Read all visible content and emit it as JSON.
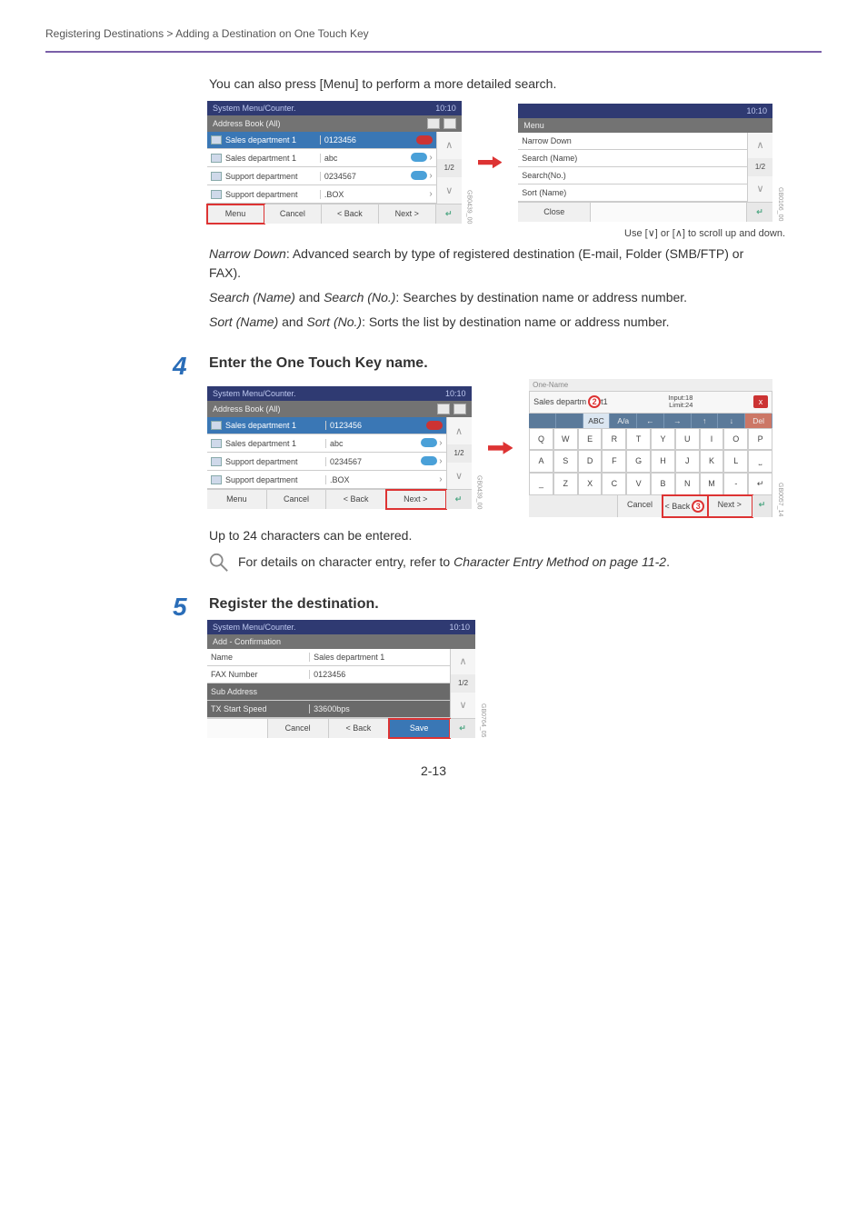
{
  "breadcrumb": "Registering Destinations > Adding a Destination on One Touch Key",
  "intro": "You can also press [Menu] to perform a more detailed search.",
  "scroll_note_pre": "Use [",
  "scroll_note_mid": "] or [",
  "scroll_note_post": "] to scroll up and down.",
  "defs": {
    "narrow_label": "Narrow Down",
    "narrow_text": ": Advanced search by type of registered destination (E-mail, Folder (SMB/FTP) or FAX).",
    "search_label_a": "Search (Name)",
    "and1": " and ",
    "search_label_b": "Search (No.)",
    "search_text": ": Searches by destination name or address number.",
    "sort_label_a": "Sort (Name)",
    "and2": " and ",
    "sort_label_b": "Sort (No.)",
    "sort_text": ": Sorts the list by destination name or address number."
  },
  "step4": {
    "num": "4",
    "title": "Enter the One Touch Key name.",
    "limit_note": "Up to 24 characters can be entered.",
    "refer_pre": "For details on character entry, refer to ",
    "refer_link": "Character Entry Method on page 11-2",
    "refer_post": "."
  },
  "step5": {
    "num": "5",
    "title": "Register the destination."
  },
  "addr_panel": {
    "title": "System Menu/Counter.",
    "time": "10:10",
    "subtitle": "Address Book (All)",
    "rows": [
      {
        "name": "Sales department 1",
        "val": "0123456",
        "pill": "red",
        "sel": true
      },
      {
        "name": "Sales department 1",
        "val": "abc",
        "pill": "blue",
        "sel": false
      },
      {
        "name": "Support department",
        "val": "0234567",
        "pill": "blue",
        "sel": false
      },
      {
        "name": "Support department",
        "val": ".BOX",
        "pill": "",
        "sel": false
      }
    ],
    "page": "1/2",
    "foot": {
      "menu": "Menu",
      "cancel": "Cancel",
      "back": "< Back",
      "next": "Next >"
    },
    "code": "GB0439_00"
  },
  "menu_panel": {
    "title": "Menu",
    "time": "10:10",
    "items": [
      "Narrow Down",
      "Search (Name)",
      "Search(No.)",
      "Sort (Name)"
    ],
    "page": "1/2",
    "close": "Close",
    "code": "GB0166_00"
  },
  "keyboard": {
    "top": "One-Name",
    "value": "Sales departm",
    "circle": "2",
    "input": "Input:18",
    "limit": "Limit:24",
    "x": "x",
    "bar": [
      "",
      "",
      "ABC",
      "A/a",
      "←",
      "→",
      "↑",
      "↓",
      "Del"
    ],
    "bar_active_idx": 2,
    "bar_del_idx": 8,
    "keys_rows": [
      [
        "Q",
        "W",
        "E",
        "R",
        "T",
        "Y",
        "U",
        "I",
        "O",
        "P"
      ],
      [
        "A",
        "S",
        "D",
        "F",
        "G",
        "H",
        "J",
        "K",
        "L",
        "⎵"
      ],
      [
        "_",
        "Z",
        "X",
        "C",
        "V",
        "B",
        "N",
        "M",
        "-",
        "↵"
      ]
    ],
    "foot": {
      "cancel": "Cancel",
      "back": "< Back",
      "next": "Next >"
    },
    "circle3": "3",
    "code": "GB0057_14"
  },
  "confirm_panel": {
    "title": "System Menu/Counter.",
    "time": "10:10",
    "subtitle": "Add - Confirmation",
    "rows": [
      {
        "label": "Name",
        "val": "Sales department 1"
      },
      {
        "label": "FAX Number",
        "val": "0123456"
      },
      {
        "label": "Sub Address",
        "val": ""
      },
      {
        "label": "TX Start Speed",
        "val": "33600bps"
      }
    ],
    "page": "1/2",
    "foot": {
      "cancel": "Cancel",
      "back": "< Back",
      "save": "Save"
    },
    "code": "GB0764_05"
  },
  "pagenum": "2-13"
}
